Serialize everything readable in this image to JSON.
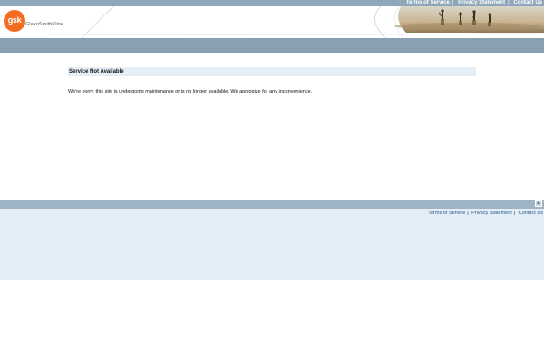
{
  "brand": {
    "mark": "gsk",
    "wordmark": "GlaxoSmithKline",
    "color": "#f36c21"
  },
  "top_nav": {
    "terms": "Terms of Service",
    "privacy": "Privacy Statement",
    "contact": "Contact Us",
    "separator": "|"
  },
  "notice": {
    "title": "Service Not Available",
    "message": "We're sorry, this site is undergoing maintenance or is no longer available. We apologize for any inconvenience."
  },
  "footer_nav": {
    "terms": "Terms of Service",
    "privacy": "Privacy Statement",
    "contact": "Contact Us",
    "separator": "|"
  },
  "icons": {
    "back_to_top": "up-arrow-icon"
  },
  "colors": {
    "bar": "#88a0b2",
    "footer_bg": "#e3edf6",
    "link": "#2a5a8a"
  }
}
